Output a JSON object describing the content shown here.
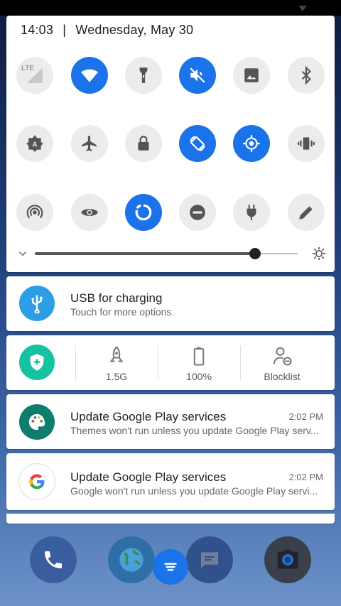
{
  "status": {
    "time": "14:03",
    "separator": "|",
    "date": "Wednesday, May 30"
  },
  "quick_settings": {
    "tiles": [
      {
        "name": "mobile-data",
        "icon": "lte-signal-icon",
        "label": "LTE",
        "on": false
      },
      {
        "name": "wifi",
        "icon": "wifi-icon",
        "on": true
      },
      {
        "name": "flashlight",
        "icon": "flashlight-icon",
        "on": false
      },
      {
        "name": "sound",
        "icon": "volume-off-icon",
        "on": true
      },
      {
        "name": "screenshot",
        "icon": "image-icon",
        "on": false
      },
      {
        "name": "bluetooth",
        "icon": "bluetooth-icon",
        "on": false
      },
      {
        "name": "auto-brightness",
        "icon": "brightness-auto-icon",
        "on": false
      },
      {
        "name": "airplane",
        "icon": "airplane-icon",
        "on": false
      },
      {
        "name": "lock",
        "icon": "lock-icon",
        "on": false
      },
      {
        "name": "auto-rotate",
        "icon": "rotate-icon",
        "on": true
      },
      {
        "name": "location",
        "icon": "location-icon",
        "on": true
      },
      {
        "name": "vibrate",
        "icon": "vibrate-icon",
        "on": false
      },
      {
        "name": "hotspot",
        "icon": "hotspot-icon",
        "on": false
      },
      {
        "name": "eye-comfort",
        "icon": "eye-icon",
        "on": false
      },
      {
        "name": "data-saver",
        "icon": "data-saver-icon",
        "on": true
      },
      {
        "name": "do-not-disturb",
        "icon": "minus-circle-icon",
        "on": false
      },
      {
        "name": "power-saver",
        "icon": "plug-icon",
        "on": false
      },
      {
        "name": "edit",
        "icon": "pencil-icon",
        "on": false
      }
    ],
    "brightness_level": 0.84,
    "accent": "#1a73e8"
  },
  "notifications": {
    "usb": {
      "title": "USB for charging",
      "subtitle": "Touch for more options."
    },
    "tools": [
      {
        "icon": "rocket-icon",
        "label": "1.5G"
      },
      {
        "icon": "battery-icon",
        "label": "100%"
      },
      {
        "icon": "person-block-icon",
        "label": "Blocklist"
      }
    ],
    "gp1": {
      "title": "Update Google Play services",
      "time": "2:02 PM",
      "subtitle": "Themes won't run unless you update Google Play serv..."
    },
    "gp2": {
      "title": "Update Google Play services",
      "time": "2:02 PM",
      "subtitle": "Google won't run unless you update Google Play servi..."
    }
  },
  "dock": [
    "phone-icon",
    "globe-icon",
    "message-icon",
    "camera-icon"
  ],
  "fab": {
    "icon": "menu-icon"
  }
}
